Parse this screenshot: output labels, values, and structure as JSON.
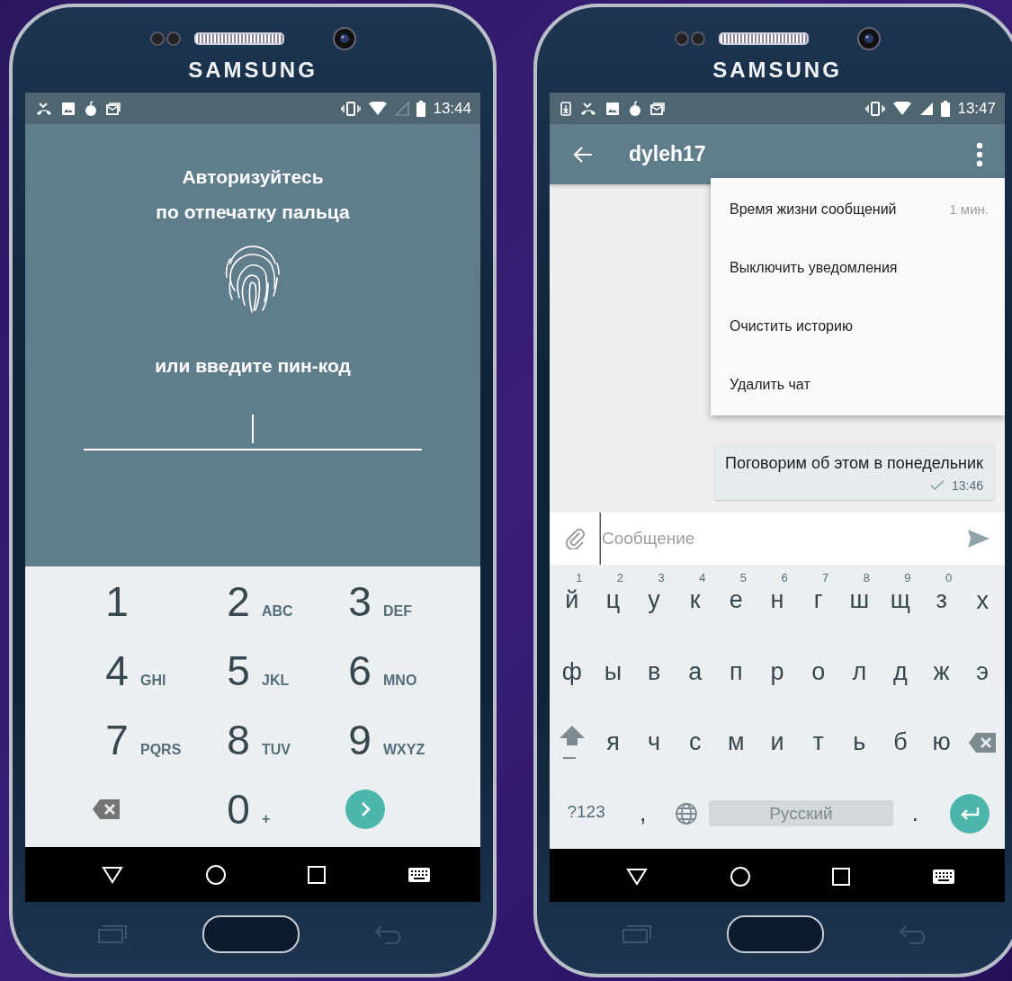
{
  "phones": [
    {
      "brand": "SAMSUNG",
      "status_time": "13:44",
      "screen": {
        "kind": "pin_lock",
        "heading": "Авторизуйтесь\nпо отпечатку пальца",
        "prompt": "или введите пин-код",
        "keys": [
          {
            "kind": "digit",
            "digit": "1"
          },
          {
            "kind": "digit",
            "digit": "2",
            "letters": "ABC"
          },
          {
            "kind": "digit",
            "digit": "3",
            "letters": "DEF"
          },
          {
            "kind": "digit",
            "digit": "4",
            "letters": "GHI"
          },
          {
            "kind": "digit",
            "digit": "5",
            "letters": "JKL"
          },
          {
            "kind": "digit",
            "digit": "6",
            "letters": "MNO"
          },
          {
            "kind": "digit",
            "digit": "7",
            "letters": "PQRS"
          },
          {
            "kind": "digit",
            "digit": "8",
            "letters": "TUV"
          },
          {
            "kind": "digit",
            "digit": "9",
            "letters": "WXYZ"
          },
          {
            "kind": "backspace"
          },
          {
            "kind": "digit",
            "digit": "0",
            "letters": "+"
          },
          {
            "kind": "go"
          }
        ]
      }
    },
    {
      "brand": "SAMSUNG",
      "status_time": "13:47",
      "screen": {
        "kind": "chat",
        "title": "dyleh17",
        "menu": [
          {
            "label": "Время жизни сообщений",
            "value": "1 мин."
          },
          {
            "label": "Выключить уведомления"
          },
          {
            "label": "Очистить историю"
          },
          {
            "label": "Удалить чат"
          }
        ],
        "messages": [
          {
            "text": "Поговорим об этом в понедельник",
            "time": "13:46",
            "sent": true
          }
        ],
        "input": {
          "placeholder": "Сообщение"
        },
        "keyboard": {
          "rows": [
            {
              "keys": [
                {
                  "kind": "char",
                  "label": "й",
                  "hint": "1"
                },
                {
                  "kind": "char",
                  "label": "ц",
                  "hint": "2"
                },
                {
                  "kind": "char",
                  "label": "у",
                  "hint": "3"
                },
                {
                  "kind": "char",
                  "label": "к",
                  "hint": "4"
                },
                {
                  "kind": "char",
                  "label": "е",
                  "hint": "5"
                },
                {
                  "kind": "char",
                  "label": "н",
                  "hint": "6"
                },
                {
                  "kind": "char",
                  "label": "г",
                  "hint": "7"
                },
                {
                  "kind": "char",
                  "label": "ш",
                  "hint": "8"
                },
                {
                  "kind": "char",
                  "label": "щ",
                  "hint": "9"
                },
                {
                  "kind": "char",
                  "label": "з",
                  "hint": "0"
                },
                {
                  "kind": "char",
                  "label": "х"
                }
              ]
            },
            {
              "keys": [
                {
                  "kind": "char",
                  "label": "ф"
                },
                {
                  "kind": "char",
                  "label": "ы"
                },
                {
                  "kind": "char",
                  "label": "в"
                },
                {
                  "kind": "char",
                  "label": "а"
                },
                {
                  "kind": "char",
                  "label": "п"
                },
                {
                  "kind": "char",
                  "label": "р"
                },
                {
                  "kind": "char",
                  "label": "о"
                },
                {
                  "kind": "char",
                  "label": "л"
                },
                {
                  "kind": "char",
                  "label": "д"
                },
                {
                  "kind": "char",
                  "label": "ж"
                },
                {
                  "kind": "char",
                  "label": "э"
                }
              ]
            },
            {
              "keys": [
                {
                  "kind": "shift"
                },
                {
                  "kind": "char",
                  "label": "я"
                },
                {
                  "kind": "char",
                  "label": "ч"
                },
                {
                  "kind": "char",
                  "label": "с"
                },
                {
                  "kind": "char",
                  "label": "м"
                },
                {
                  "kind": "char",
                  "label": "и"
                },
                {
                  "kind": "char",
                  "label": "т"
                },
                {
                  "kind": "char",
                  "label": "ь"
                },
                {
                  "kind": "char",
                  "label": "б"
                },
                {
                  "kind": "char",
                  "label": "ю"
                },
                {
                  "kind": "backspace"
                }
              ]
            },
            {
              "keys": [
                {
                  "kind": "symbols",
                  "label": "?123"
                },
                {
                  "kind": "char",
                  "label": ","
                },
                {
                  "kind": "globe"
                },
                {
                  "kind": "space",
                  "label": "Русский"
                },
                {
                  "kind": "char",
                  "label": "."
                },
                {
                  "kind": "enter"
                }
              ]
            }
          ]
        }
      }
    }
  ]
}
